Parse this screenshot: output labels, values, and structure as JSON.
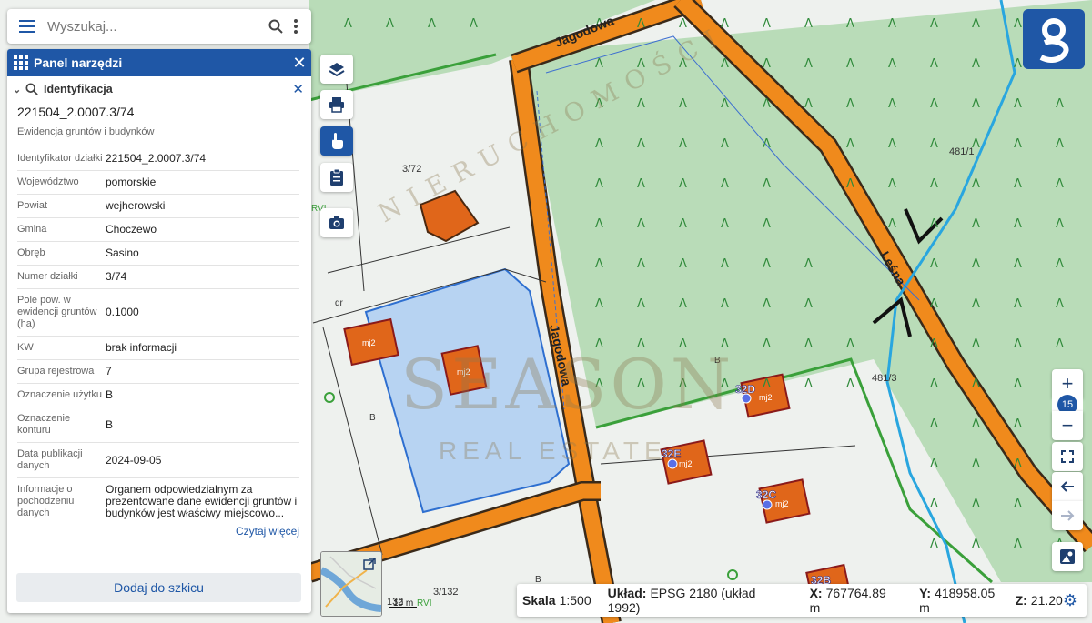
{
  "search": {
    "placeholder": "Wyszukaj..."
  },
  "panel": {
    "title": "Panel narzędzi",
    "section": "Identyfikacja",
    "parcel_id": "221504_2.0007.3/74",
    "subtitle": "Ewidencja gruntów i budynków",
    "rows": [
      {
        "k": "Identyfikator działki",
        "v": "221504_2.0007.3/74"
      },
      {
        "k": "Województwo",
        "v": "pomorskie"
      },
      {
        "k": "Powiat",
        "v": "wejherowski"
      },
      {
        "k": "Gmina",
        "v": "Choczewo"
      },
      {
        "k": "Obręb",
        "v": "Sasino"
      },
      {
        "k": "Numer działki",
        "v": "3/74"
      },
      {
        "k": "Pole pow. w ewidencji gruntów (ha)",
        "v": "0.1000"
      },
      {
        "k": "KW",
        "v": "brak informacji"
      },
      {
        "k": "Grupa rejestrowa",
        "v": "7"
      },
      {
        "k": "Oznaczenie użytku",
        "v": "B"
      },
      {
        "k": "Oznaczenie konturu",
        "v": "B"
      },
      {
        "k": "Data publikacji danych",
        "v": "2024-09-05"
      },
      {
        "k": "Informacje o pochodzeniu danych",
        "v": "Organem odpowiedzialnym za prezentowane dane ewidencji gruntów i budynków jest właściwy miejscowo..."
      }
    ],
    "read_more": "Czytaj więcej",
    "add_button": "Dodaj do szkicu"
  },
  "status": {
    "scale_label": "Skala",
    "scale": "1:500",
    "crs_label": "Układ:",
    "crs": "EPSG 2180 (układ 1992)",
    "x_label": "X:",
    "x": "767764.89 m",
    "y_label": "Y:",
    "y": "418958.05 m",
    "z_label": "Z:",
    "z": "21.20"
  },
  "zoom": {
    "level": "15",
    "plus": "+",
    "minus": "−"
  },
  "map": {
    "streets": [
      "Jagodowa",
      "Jagodowa",
      "Leśna"
    ],
    "parcels": [
      "3/72",
      "481/1",
      "481/3",
      "3/132",
      "132"
    ],
    "buildings": [
      "32D",
      "32E",
      "32C",
      "32B"
    ],
    "labels": {
      "mj2": "mj2",
      "dr": "dr",
      "b": "B",
      "rvi": "RVI",
      "lambda": "Λ"
    },
    "scalebar": "10 m"
  },
  "watermark": {
    "top": "NIERUCHOMOŚCI",
    "main": "SEASON",
    "sub": "REAL ESTATE"
  },
  "colors": {
    "accent": "#1f57a6",
    "road": "#f08a1c",
    "forest": "#b9dcb8",
    "selected": "#b7d3f2",
    "building": "#e0661a"
  },
  "icons": [
    "menu-icon",
    "search-icon",
    "more-vert-icon",
    "grid-icon",
    "close-icon",
    "layers-icon",
    "print-icon",
    "identify-hand-icon",
    "clipboard-icon",
    "camera-icon",
    "fullscreen-icon",
    "back-arrow-icon",
    "forward-arrow-icon",
    "basemap-icon",
    "settings-gear-icon",
    "geoportal-logo-icon",
    "external-link-icon"
  ]
}
